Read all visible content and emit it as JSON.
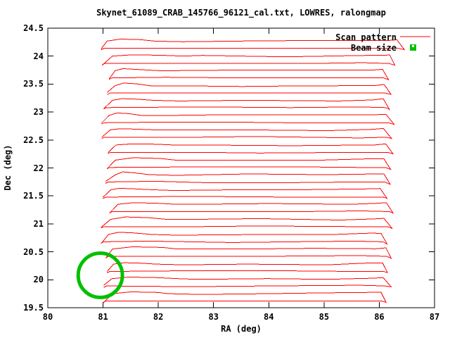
{
  "title": "Skynet_61089_CRAB_145766_96121_cal.txt, LOWRES, ralongmap",
  "axes": {
    "x_label": "RA (deg)",
    "y_label": "Dec (deg)"
  },
  "legend": {
    "scan_pattern_label": "Scan pattern",
    "beam_size_label": "Beam size"
  },
  "colors": {
    "scan": "#ff0000",
    "beam": "#00c000",
    "axis": "#000000",
    "background": "#ffffff"
  },
  "chart_data": {
    "type": "line",
    "title": "Skynet_61089_CRAB_145766_96121_cal.txt, LOWRES, ralongmap",
    "xlabel": "RA (deg)",
    "ylabel": "Dec (deg)",
    "xlim": [
      80,
      87
    ],
    "ylim": [
      19.5,
      24.5
    ],
    "xticks": [
      80,
      81,
      82,
      83,
      84,
      85,
      86,
      87
    ],
    "yticks": [
      19.5,
      20,
      20.5,
      21,
      21.5,
      22,
      22.5,
      23,
      23.5,
      24,
      24.5
    ],
    "grid": false,
    "legend_position": "top-right-inside",
    "series": [
      {
        "name": "Scan pattern",
        "color": "#ff0000",
        "style": "raster-scan-boustrophedon",
        "ra_scan_start": 81.18,
        "ra_scan_end": 86.08,
        "ra_return_left": 81.04,
        "ra_return_right": 86.18,
        "return_dec_offset": -0.13,
        "scan_dec_rows": [
          24.27,
          24.0,
          23.74,
          23.47,
          23.21,
          22.94,
          22.68,
          22.41,
          22.14,
          21.88,
          21.61,
          21.35,
          21.08,
          20.81,
          20.55,
          20.28,
          20.02,
          19.75
        ]
      },
      {
        "name": "Beam size",
        "color": "#00c000",
        "style": "circle-outline",
        "center_ra": 80.95,
        "center_dec": 20.08,
        "radius_deg": 0.4
      }
    ]
  }
}
